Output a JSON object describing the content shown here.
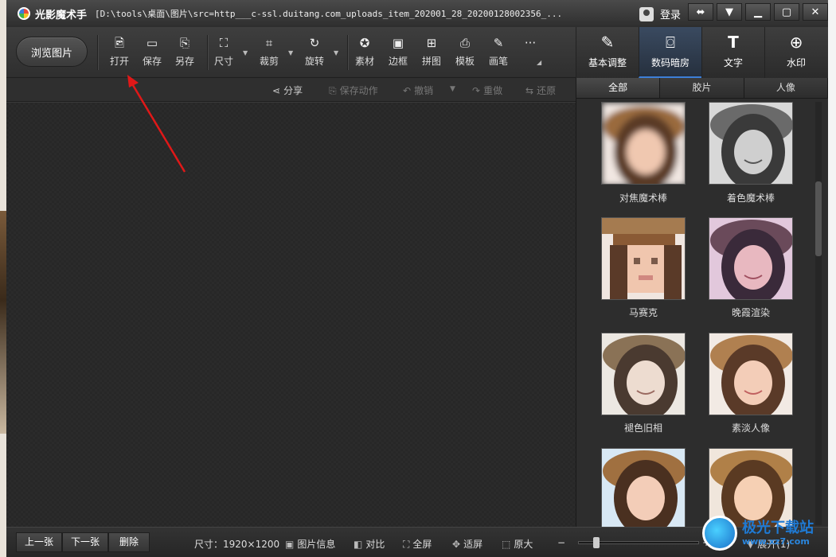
{
  "titlebar": {
    "app_name": "光影魔术手",
    "file_path": "[D:\\tools\\桌面\\图片\\src=http___c-ssl.duitang.com_uploads_item_202001_28_20200128002356_...",
    "login_label": "登录"
  },
  "toolbar": {
    "browse_label": "浏览图片",
    "items": [
      {
        "label": "打开",
        "icon": "open-image-icon"
      },
      {
        "label": "保存",
        "icon": "save-icon"
      },
      {
        "label": "另存",
        "icon": "save-as-icon"
      },
      {
        "label": "尺寸",
        "icon": "resize-icon"
      },
      {
        "label": "裁剪",
        "icon": "crop-icon"
      },
      {
        "label": "旋转",
        "icon": "rotate-icon"
      },
      {
        "label": "素材",
        "icon": "material-icon"
      },
      {
        "label": "边框",
        "icon": "border-icon"
      },
      {
        "label": "拼图",
        "icon": "collage-icon"
      },
      {
        "label": "模板",
        "icon": "template-icon"
      },
      {
        "label": "画笔",
        "icon": "brush-icon"
      },
      {
        "label": "···",
        "icon": "more-icon"
      }
    ]
  },
  "right_tabs": [
    {
      "label": "基本调整",
      "icon": "adjust-icon"
    },
    {
      "label": "数码暗房",
      "icon": "darkroom-icon"
    },
    {
      "label": "文字",
      "icon": "text-icon"
    },
    {
      "label": "水印",
      "icon": "watermark-icon"
    }
  ],
  "subbar": {
    "share": "分享",
    "save_action": "保存动作",
    "undo": "撤销",
    "redo": "重做",
    "restore": "还原"
  },
  "filter_tabs": [
    "全部",
    "胶片",
    "人像"
  ],
  "filters": [
    {
      "label": "对焦魔术棒"
    },
    {
      "label": "着色魔术棒"
    },
    {
      "label": "马赛克"
    },
    {
      "label": "晚霞渲染"
    },
    {
      "label": "褪色旧相"
    },
    {
      "label": "素淡人像"
    },
    {
      "label": ""
    },
    {
      "label": ""
    }
  ],
  "statusbar": {
    "prev": "上一张",
    "next": "下一张",
    "delete": "删除",
    "size_label": "尺寸：1920×1200",
    "image_info": "图片信息",
    "compare": "对比",
    "fullscreen": "全屏",
    "fit": "适屏",
    "original": "原大",
    "zoom_minus": "−",
    "zoom_plus": "+",
    "expand": "展开(1)"
  },
  "watermark": {
    "title": "极光下载站",
    "url": "www.xz7.com"
  }
}
